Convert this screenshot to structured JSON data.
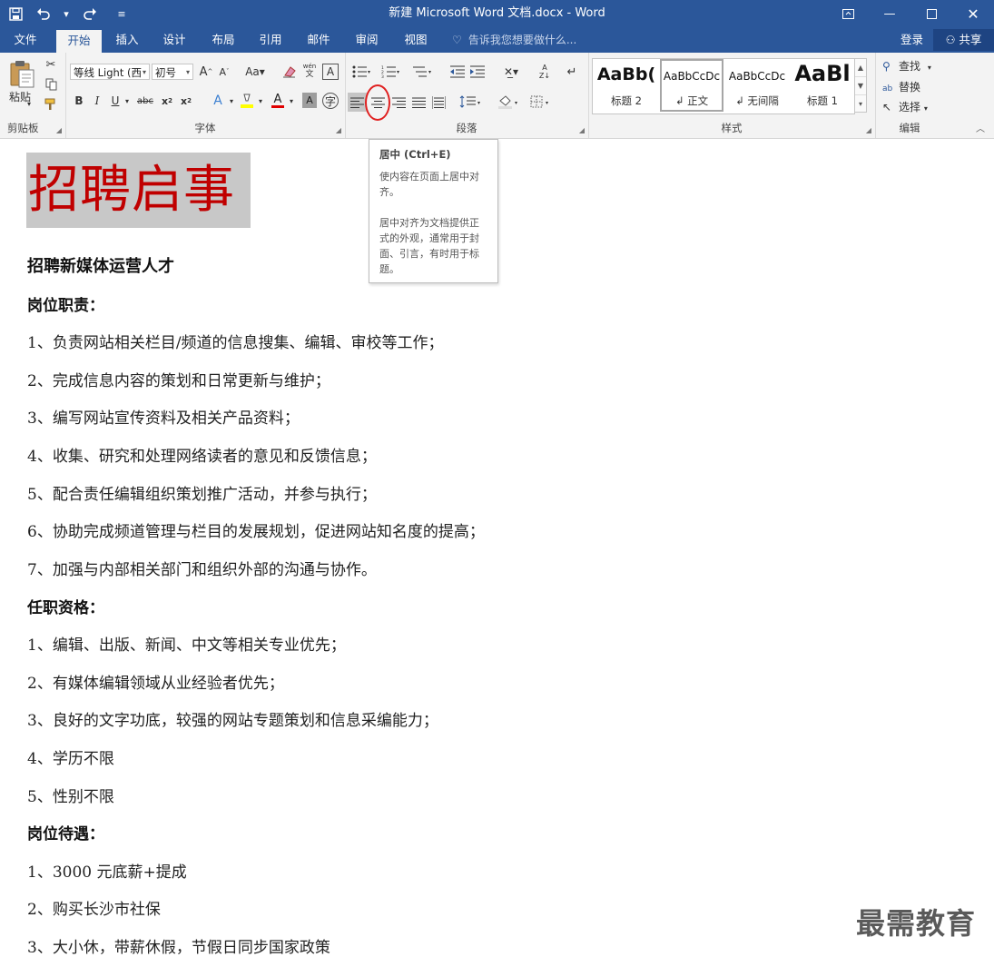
{
  "window": {
    "title": "新建 Microsoft Word 文档.docx - Word",
    "qat": {
      "save_icon": "save-icon",
      "undo_icon": "undo-icon",
      "redo_icon": "redo-icon",
      "customize_icon": "customize-qat-icon"
    },
    "controls": {
      "ribbon_options": "ribbon-display-options-icon",
      "minimize": "minimize-icon",
      "maximize": "maximize-icon",
      "close": "close-icon"
    }
  },
  "tabs": [
    {
      "label": "文件"
    },
    {
      "label": "开始"
    },
    {
      "label": "插入"
    },
    {
      "label": "设计"
    },
    {
      "label": "布局"
    },
    {
      "label": "引用"
    },
    {
      "label": "邮件"
    },
    {
      "label": "审阅"
    },
    {
      "label": "视图"
    }
  ],
  "active_tab": "开始",
  "tell_me": "告诉我您想要做什么...",
  "login": "登录",
  "share": "共享",
  "ribbon": {
    "clipboard": {
      "label": "剪贴板",
      "paste": "粘贴"
    },
    "font": {
      "label": "字体",
      "font_name": "等线 Light (西",
      "font_size": "初号"
    },
    "paragraph": {
      "label": "段落"
    },
    "styles": {
      "label": "样式",
      "items": [
        {
          "preview": "AaBb(",
          "name": "标题 2"
        },
        {
          "preview": "AaBbCcDc",
          "name": "↲ 正文"
        },
        {
          "preview": "AaBbCcDc",
          "name": "↲ 无间隔"
        },
        {
          "preview": "AaBl",
          "name": "标题 1"
        }
      ]
    },
    "editing": {
      "label": "编辑",
      "find": "查找",
      "replace": "替换",
      "select": "选择"
    }
  },
  "tooltip": {
    "title": "居中 (Ctrl+E)",
    "p1": "使内容在页面上居中对齐。",
    "p2": "居中对齐为文档提供正式的外观，通常用于封面、引言，有时用于标题。"
  },
  "document": {
    "title": "招聘启事",
    "subtitle": "招聘新媒体运营人才",
    "sections": {
      "duties_heading": "岗位职责：",
      "duties": [
        "1、负责网站相关栏目/频道的信息搜集、编辑、审校等工作；",
        "2、完成信息内容的策划和日常更新与维护；",
        "3、编写网站宣传资料及相关产品资料；",
        "4、收集、研究和处理网络读者的意见和反馈信息；",
        "5、配合责任编辑组织策划推广活动，并参与执行；",
        "6、协助完成频道管理与栏目的发展规划，促进网站知名度的提高；",
        "7、加强与内部相关部门和组织外部的沟通与协作。"
      ],
      "qual_heading": "任职资格：",
      "quals": [
        "1、编辑、出版、新闻、中文等相关专业优先；",
        "2、有媒体编辑领域从业经验者优先；",
        "3、良好的文字功底，较强的网站专题策划和信息采编能力；",
        "4、学历不限",
        "5、性别不限"
      ],
      "benefit_heading": "岗位待遇：",
      "benefits": [
        "1、3000 元底薪+提成",
        "2、购买长沙市社保",
        "3、大小休，带薪休假，节假日同步国家政策"
      ]
    }
  },
  "watermark": "最需教育",
  "colors": {
    "brand": "#2b579a",
    "title_red": "#c00000",
    "highlight": "#c8c8c8",
    "annotation": "#e02020"
  }
}
